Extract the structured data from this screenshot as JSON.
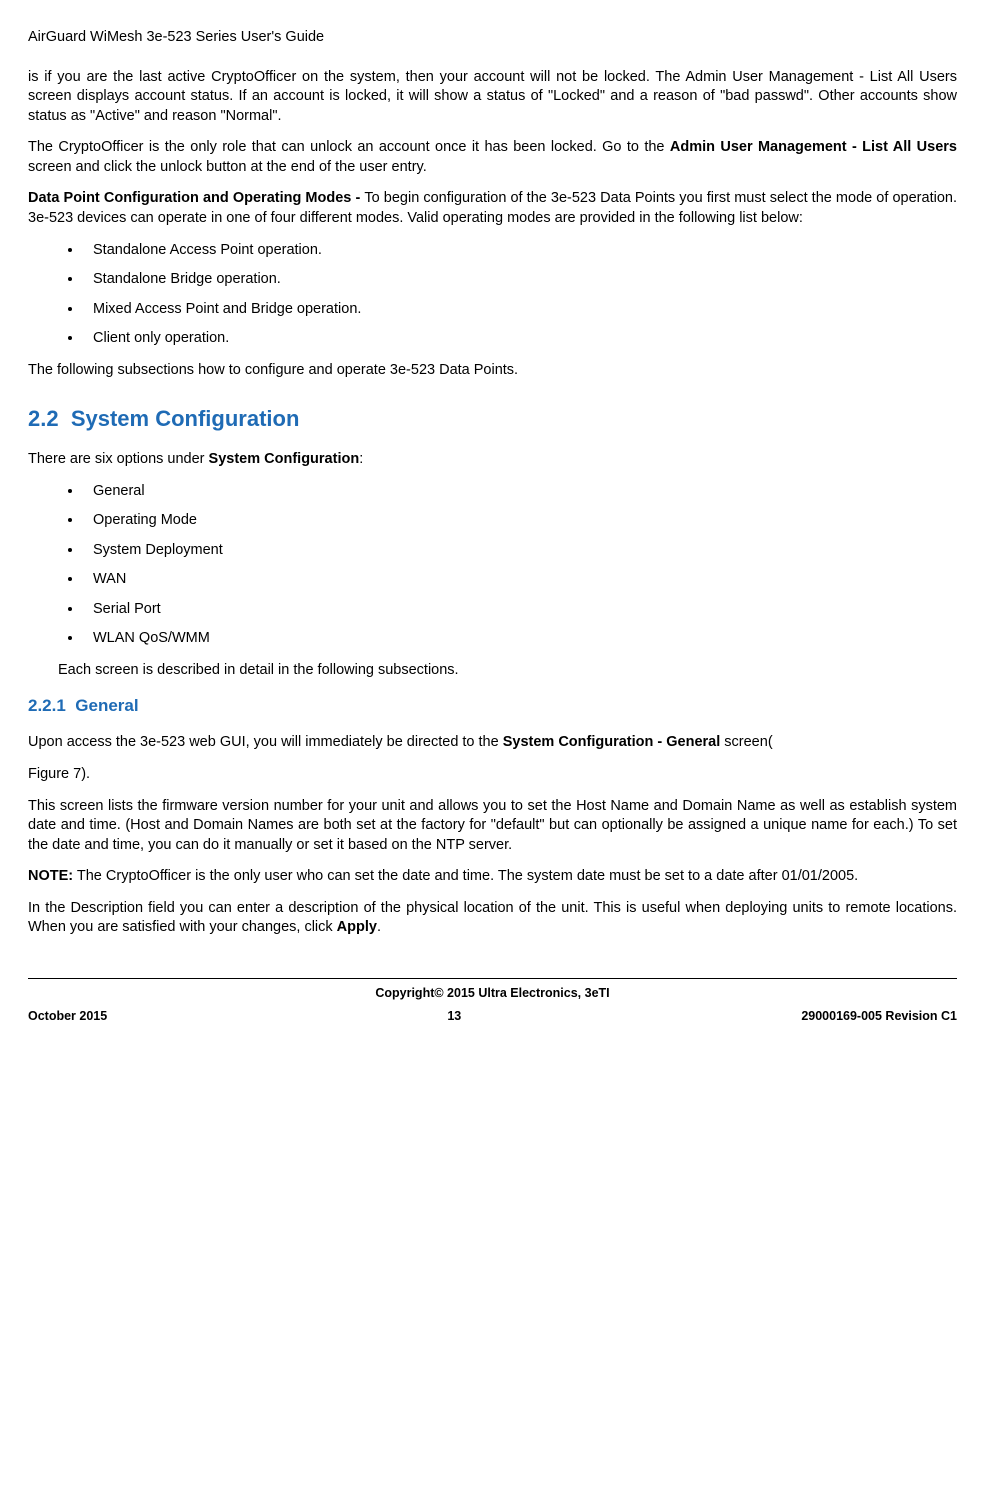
{
  "header": {
    "title": "AirGuard WiMesh 3e-523 Series User's Guide"
  },
  "body": {
    "para1": "is if you are the last active CryptoOfficer on the system, then your account will not be locked. The Admin User Management - List All Users screen displays account status. If an account is locked, it will show a status of \"Locked\" and a reason of \"bad passwd\". Other accounts show status as \"Active\" and reason \"Normal\".",
    "para2_pre": "The CryptoOfficer is the only role that can unlock an account once it has been locked. Go to the ",
    "para2_bold": "Admin User Management - List All Users",
    "para2_post": " screen and click the unlock button at the end of the user entry.",
    "para3_bold": "Data Point Configuration and Operating Modes - ",
    "para3_post": "To begin configuration of the 3e-523 Data Points you first must select the mode of operation. 3e-523 devices can operate in one of four different modes. Valid operating modes are provided in the following list below:",
    "list1": {
      "i0": "Standalone Access Point operation.",
      "i1": "Standalone Bridge operation.",
      "i2": "Mixed Access Point and Bridge operation.",
      "i3": "Client only operation."
    },
    "para4": "The following subsections how to configure and operate 3e-523 Data Points.",
    "h2_num": "2.2",
    "h2_title": "System Configuration",
    "para5_pre": "There are six options under ",
    "para5_bold": "System Configuration",
    "para5_post": ":",
    "list2": {
      "i0": "General",
      "i1": "Operating Mode",
      "i2": "System Deployment",
      "i3": "WAN",
      "i4": "Serial Port",
      "i5": "WLAN QoS/WMM"
    },
    "para6": "Each screen is described in detail in the following subsections.",
    "h3_num": "2.2.1",
    "h3_title": "General",
    "para7_pre": "Upon access the 3e-523 web GUI, you will immediately be directed to the ",
    "para7_bold": "System Configuration - General",
    "para7_post": " screen(",
    "para8": "Figure 7).",
    "para9": "This screen lists the firmware version number for your unit and allows you to set the Host Name and Domain Name as well as establish system date and time. (Host and Domain Names are both set at the factory for \"default\" but can optionally be assigned a unique name for each.) To set the date and time, you can do it manually or set it based on the NTP server.",
    "para10_bold": "NOTE:",
    "para10_post": " The CryptoOfficer is the only user who can set the date and time. The system date must be set to a date after 01/01/2005.",
    "para11_pre": "In the Description field you can enter a description of the physical location of the unit. This is useful when deploying units to remote locations. When you are satisfied with your changes, click ",
    "para11_bold": "Apply",
    "para11_post": "."
  },
  "footer": {
    "copyright": "Copyright© 2015 Ultra Electronics, 3eTI",
    "left": "October 2015",
    "center": "13",
    "right": "29000169-005 Revision C1"
  }
}
